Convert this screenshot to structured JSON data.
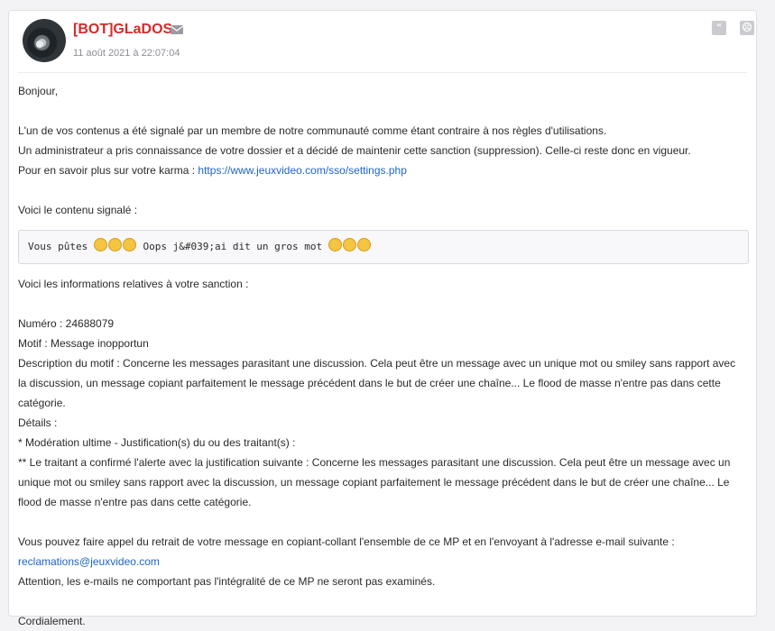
{
  "post": {
    "username": "[BOT]GLaDOS",
    "date": "11 août 2021 à 22:07:04",
    "quote_icon": "quote-icon",
    "report_icon": "report-icon",
    "mail_icon": "mail-icon"
  },
  "message": {
    "greeting": "Bonjour,",
    "line1": "L'un de vos contenus a été signalé par un membre de notre communauté comme étant contraire à nos règles d'utilisations.",
    "line2": "Un administrateur a pris connaissance de votre dossier et a décidé de maintenir cette sanction (suppression). Celle-ci reste donc en vigueur.",
    "karma_prefix": "Pour en savoir plus sur votre karma : ",
    "karma_link": "https://www.jeuxvideo.com/sso/settings.php",
    "reported_intro": "Voici le contenu signalé :",
    "reported_text_a": "Vous pûtes ",
    "reported_text_b": " Oops j&#039;ai dit un gros mot ",
    "sanction_intro": "Voici les informations relatives à votre sanction :",
    "numero": "Numéro : 24688079",
    "motif": "Motif : Message inopportun",
    "description_l1": "Description du motif : Concerne les messages parasitant une discussion. Cela peut être un message avec un unique mot ou smiley sans rapport avec",
    "description_l2": "la discussion, un message copiant parfaitement le message précédent dans le but de créer une chaîne... Le flood de masse n'entre pas dans cette",
    "description_l3": "catégorie.",
    "details": "Détails :",
    "moderation": "* Modération ultime - Justification(s) du ou des traitant(s) :",
    "traitant_l1": "** Le traitant a confirmé l'alerte avec la justification suivante : Concerne les messages parasitant une discussion. Cela peut être un message avec un",
    "traitant_l2": "unique mot ou smiley sans rapport avec la discussion, un message copiant parfaitement le message précédent dans le but de créer une chaîne... Le",
    "traitant_l3": "flood de masse n'entre pas dans cette catégorie.",
    "appeal": "Vous pouvez faire appel du retrait de votre message en copiant-collant l'ensemble de ce MP et en l'envoyant à l'adresse e-mail suivante :",
    "email": "reclamations@jeuxvideo.com",
    "warning": "Attention, les e-mails ne comportant pas l'intégralité de ce MP ne seront pas examinés.",
    "closing": "Cordialement."
  }
}
